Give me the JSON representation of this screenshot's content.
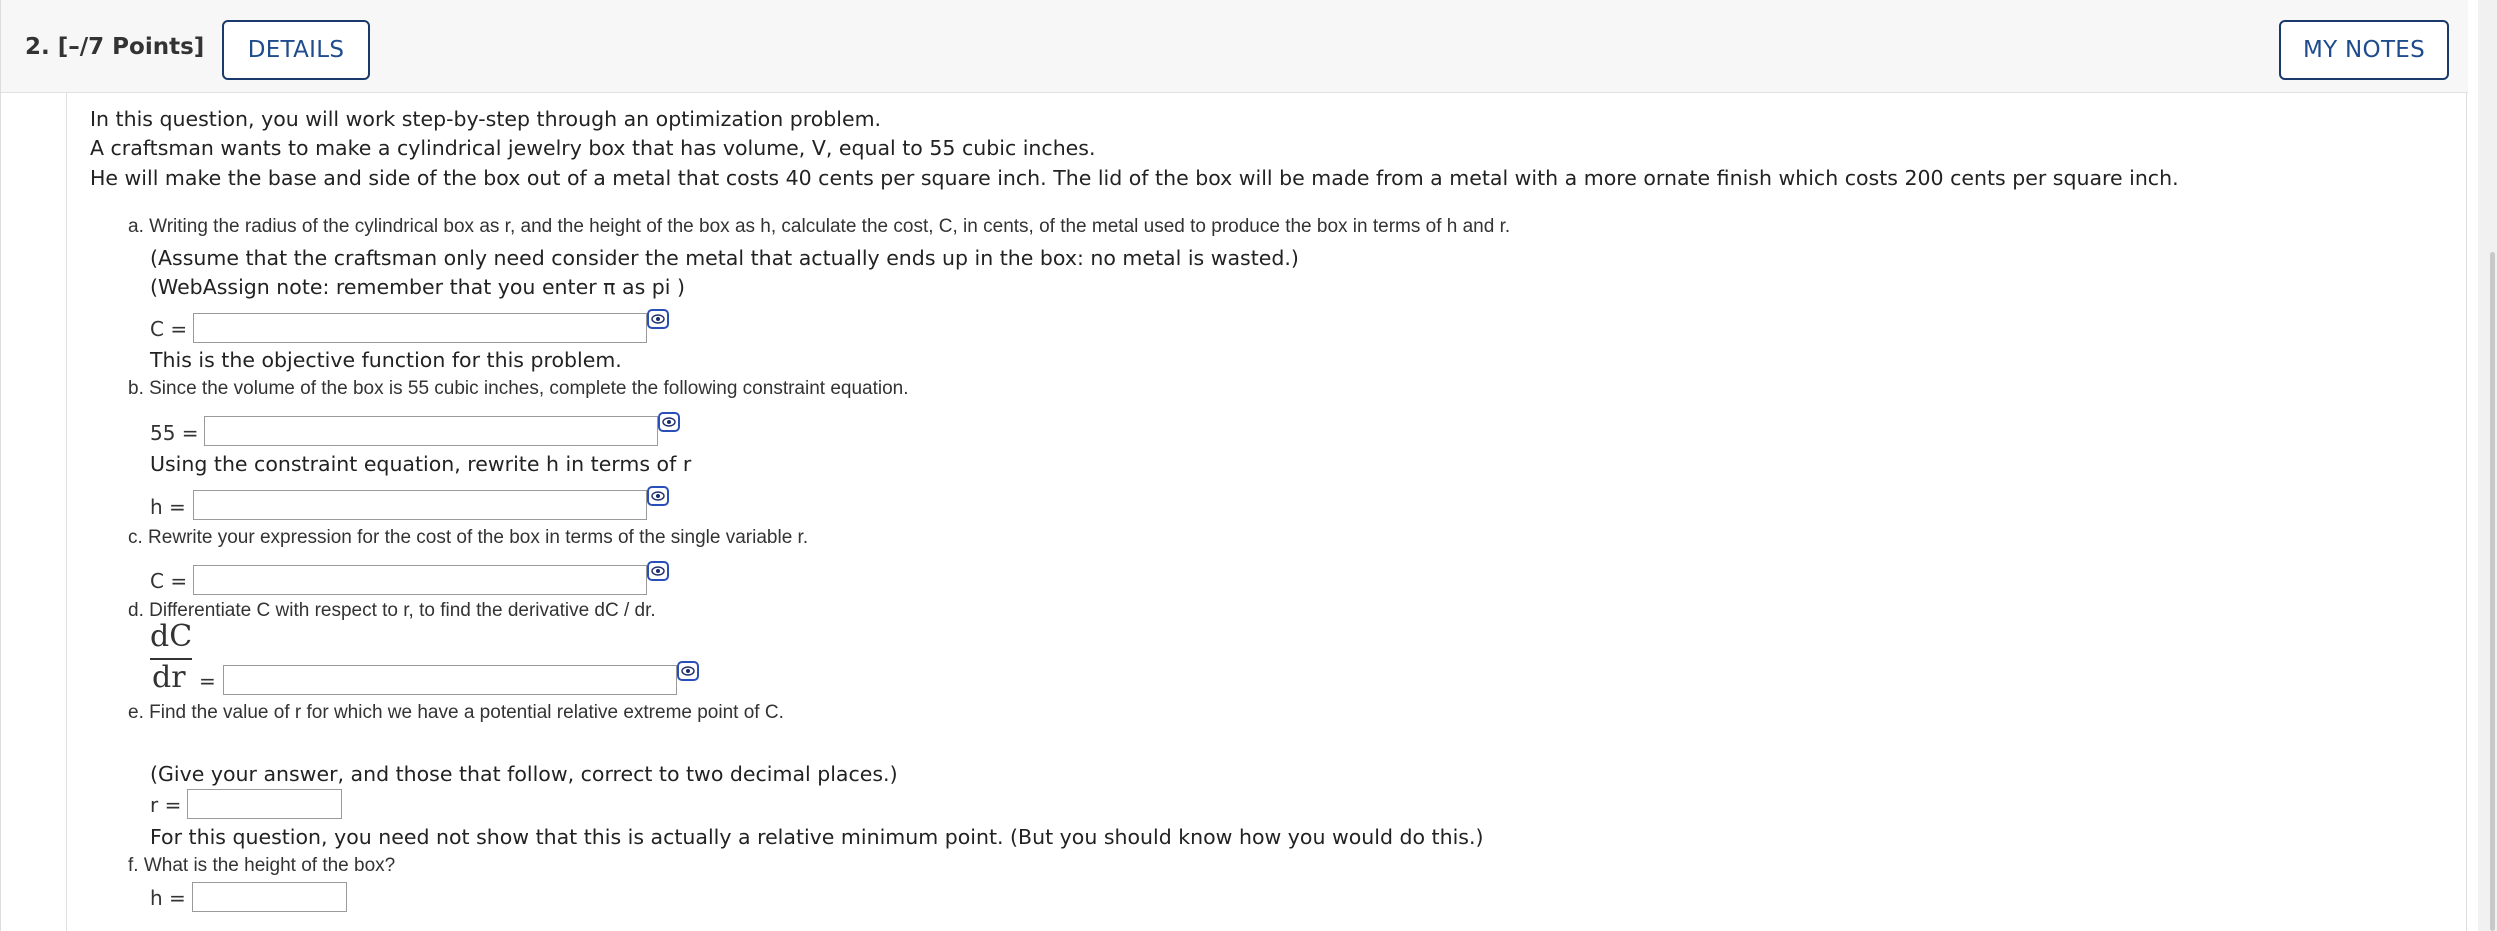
{
  "header": {
    "question_label": "2. [–/7 Points]",
    "details_label": "DETAILS",
    "notes_label": "MY NOTES"
  },
  "intro": {
    "line1": "In this question, you will work step-by-step through an optimization problem.",
    "line2": "A craftsman wants to make a cylindrical jewelry box that has volume, V, equal to 55 cubic inches.",
    "line3": "He will make the base and side of the box out of a metal that costs 40 cents per square inch. The lid of the box will be made from a metal with a more ornate finish which costs 200 cents per square inch."
  },
  "parts": {
    "a": {
      "prompt": "a. Writing the radius of the cylindrical box as r, and the height of the box as h, calculate the cost, C, in cents, of the metal used to produce the box in terms of h and r.",
      "note1": "(Assume that the craftsman only need consider the metal that actually ends up in the box: no metal is wasted.)",
      "note2": "(WebAssign note: remember that you enter π as pi )",
      "label": "C =",
      "after": "This is the objective function for this problem."
    },
    "b": {
      "prompt": "b. Since the volume of the box is 55 cubic inches, complete the following constraint equation.",
      "label": "55 =",
      "mid": "Using the constraint equation, rewrite h in terms of r",
      "label2": "h ="
    },
    "c": {
      "prompt": "c. Rewrite your expression for the cost of the box in terms of the single variable r.",
      "label": "C ="
    },
    "d": {
      "prompt": "d. Differentiate C with respect to r, to find the derivative dC / dr.",
      "frac_num": "dC",
      "frac_den": "dr",
      "eq": "="
    },
    "e": {
      "prompt": "e. Find the value of r for which we have a potential relative extreme point of C.",
      "note": "(Give your answer, and those that follow, correct to two decimal places.)",
      "label": "r =",
      "after": "For this question, you need not show that this is actually a relative minimum point. (But you should know how you would do this.)"
    },
    "f": {
      "prompt": "f. What is the height of the box?",
      "label": "h ="
    }
  }
}
